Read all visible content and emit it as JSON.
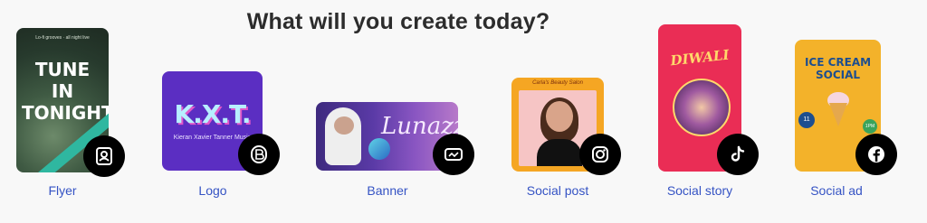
{
  "header": {
    "title": "What will you create today?"
  },
  "cards": [
    {
      "label": "Flyer",
      "icon": "flyer-icon",
      "preview_small": "Lo-fi grooves · all night live",
      "preview_text": "TUNE IN TONIGHT"
    },
    {
      "label": "Logo",
      "icon": "logo-icon",
      "preview_text": "K.X.T.",
      "preview_sub": "Kieran Xavier Tanner Music"
    },
    {
      "label": "Banner",
      "icon": "banner-icon",
      "preview_text": "Lunazz"
    },
    {
      "label": "Social post",
      "icon": "instagram-icon",
      "preview_text": "Carla's Beauty Salon"
    },
    {
      "label": "Social story",
      "icon": "tiktok-icon",
      "preview_text": "DIWALI"
    },
    {
      "label": "Social ad",
      "icon": "facebook-icon",
      "preview_text": "ICE CREAM SOCIAL",
      "preview_date": "11",
      "preview_time": "1PM"
    }
  ],
  "colors": {
    "link": "#3553c4",
    "badge": "#000000",
    "background": "#f8f8f8"
  }
}
